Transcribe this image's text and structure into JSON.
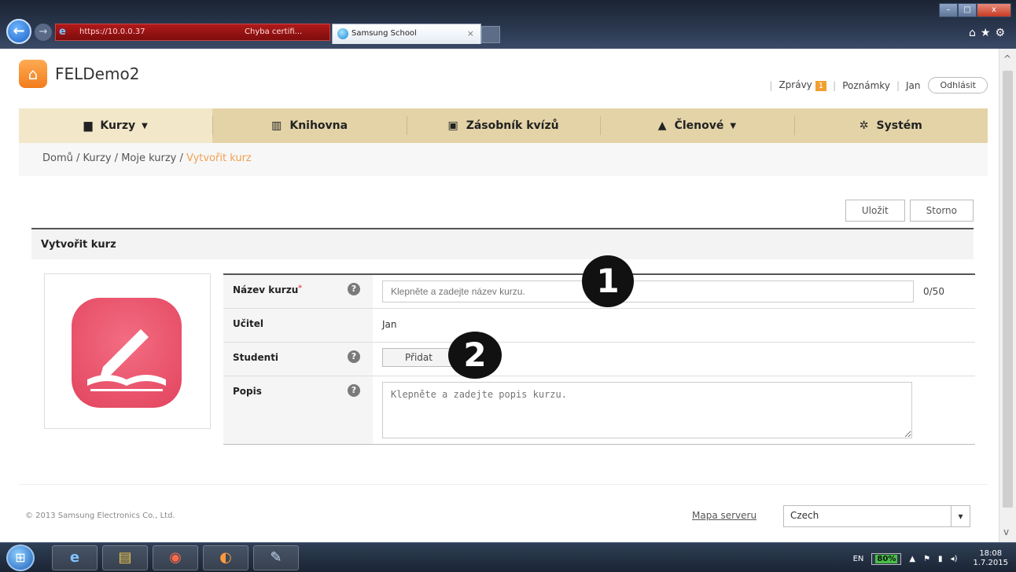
{
  "browser": {
    "address_text": "https://10.0.0.37",
    "cert_error_label": "Chyba certifi...",
    "tab_title": "Samsung School",
    "back_glyph": "←",
    "forward_glyph": "→"
  },
  "app": {
    "name": "FELDemo2"
  },
  "topnav": {
    "messages_label": "Zprávy",
    "messages_count": "1",
    "notes_label": "Poznámky",
    "user_name": "Jan",
    "logout_label": "Odhlásit"
  },
  "menu": [
    {
      "label": "Kurzy",
      "icon": "book-icon",
      "has_dropdown": true
    },
    {
      "label": "Knihovna",
      "icon": "library-icon",
      "has_dropdown": false
    },
    {
      "label": "Zásobník kvízů",
      "icon": "quiz-icon",
      "has_dropdown": false
    },
    {
      "label": "Členové",
      "icon": "person-icon",
      "has_dropdown": true
    },
    {
      "label": "Systém",
      "icon": "gear-icon",
      "has_dropdown": false
    }
  ],
  "breadcrumb": {
    "items": [
      "Domů",
      "Kurzy",
      "Moje kurzy"
    ],
    "current": "Vytvořit kurz",
    "separator": "/"
  },
  "actions": {
    "save_label": "Uložit",
    "cancel_label": "Storno"
  },
  "section": {
    "title": "Vytvořit kurz"
  },
  "form": {
    "course_name_label": "Název kurzu",
    "course_name_required_mark": "*",
    "course_name_placeholder": "Klepněte a zadejte název kurzu.",
    "course_name_counter": "0/50",
    "teacher_label": "Učitel",
    "teacher_value": "Jan",
    "students_label": "Studenti",
    "students_add_label": "Přidat",
    "description_label": "Popis",
    "description_placeholder": "Klepněte a zadejte popis kurzu."
  },
  "markers": [
    "1",
    "2"
  ],
  "footer": {
    "copyright": "© 2013 Samsung Electronics Co., Ltd.",
    "sitemap_label": "Mapa serveru",
    "language_value": "Czech"
  },
  "taskbar": {
    "lang": "EN",
    "battery": "80%",
    "time": "18:08",
    "date": "1.7.2015"
  },
  "colors": {
    "menubar": "#e3d3a7",
    "breadcrumb_current": "#f0a050",
    "course_icon": "#e2445e",
    "logo": "#f27c1b"
  }
}
